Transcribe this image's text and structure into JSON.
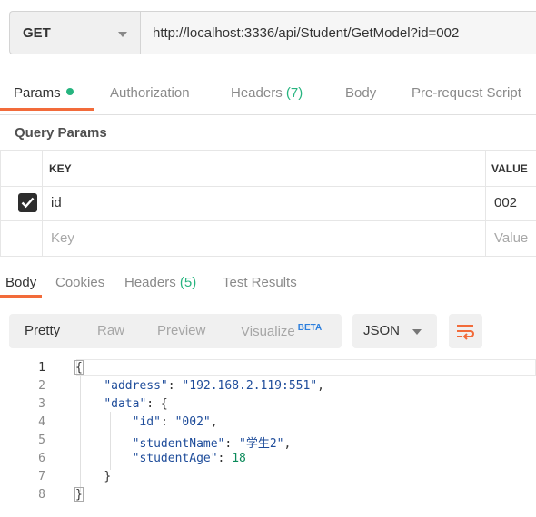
{
  "request": {
    "method": "GET",
    "url": "http://localhost:3336/api/Student/GetModel?id=002"
  },
  "request_tabs": {
    "params": "Params",
    "authorization": "Authorization",
    "headers": "Headers",
    "headers_count": "(7)",
    "body": "Body",
    "pre_request": "Pre-request Script"
  },
  "query_params": {
    "title": "Query Params",
    "col_key": "KEY",
    "col_value": "VALUE",
    "rows": [
      {
        "checked": true,
        "key": "id",
        "value": "002"
      }
    ],
    "key_placeholder": "Key",
    "value_placeholder": "Value"
  },
  "response_tabs": {
    "body": "Body",
    "cookies": "Cookies",
    "headers": "Headers",
    "headers_count": "(5)",
    "test_results": "Test Results"
  },
  "view_modes": {
    "pretty": "Pretty",
    "raw": "Raw",
    "preview": "Preview",
    "visualize": "Visualize",
    "beta": "BETA"
  },
  "format": {
    "selected": "JSON"
  },
  "code": {
    "line_numbers": [
      "1",
      "2",
      "3",
      "4",
      "5",
      "6",
      "7",
      "8"
    ],
    "open_brace": "{",
    "address_key": "\"address\"",
    "address_value": "\"192.168.2.119:551\"",
    "data_key": "\"data\"",
    "data_open": ": {",
    "id_key": "\"id\"",
    "id_value": "\"002\"",
    "name_key": "\"studentName\"",
    "name_value": "\"学生2\"",
    "age_key": "\"studentAge\"",
    "age_value": "18",
    "inner_close": "}",
    "outer_close": "}"
  },
  "colors": {
    "accent": "#f26b3a",
    "green": "#26b47f",
    "string": "#1e4c9a",
    "number": "#0b8a5a"
  },
  "icons": [
    "chevron-down-icon",
    "checkbox-checked-icon",
    "wrap-lines-icon"
  ]
}
